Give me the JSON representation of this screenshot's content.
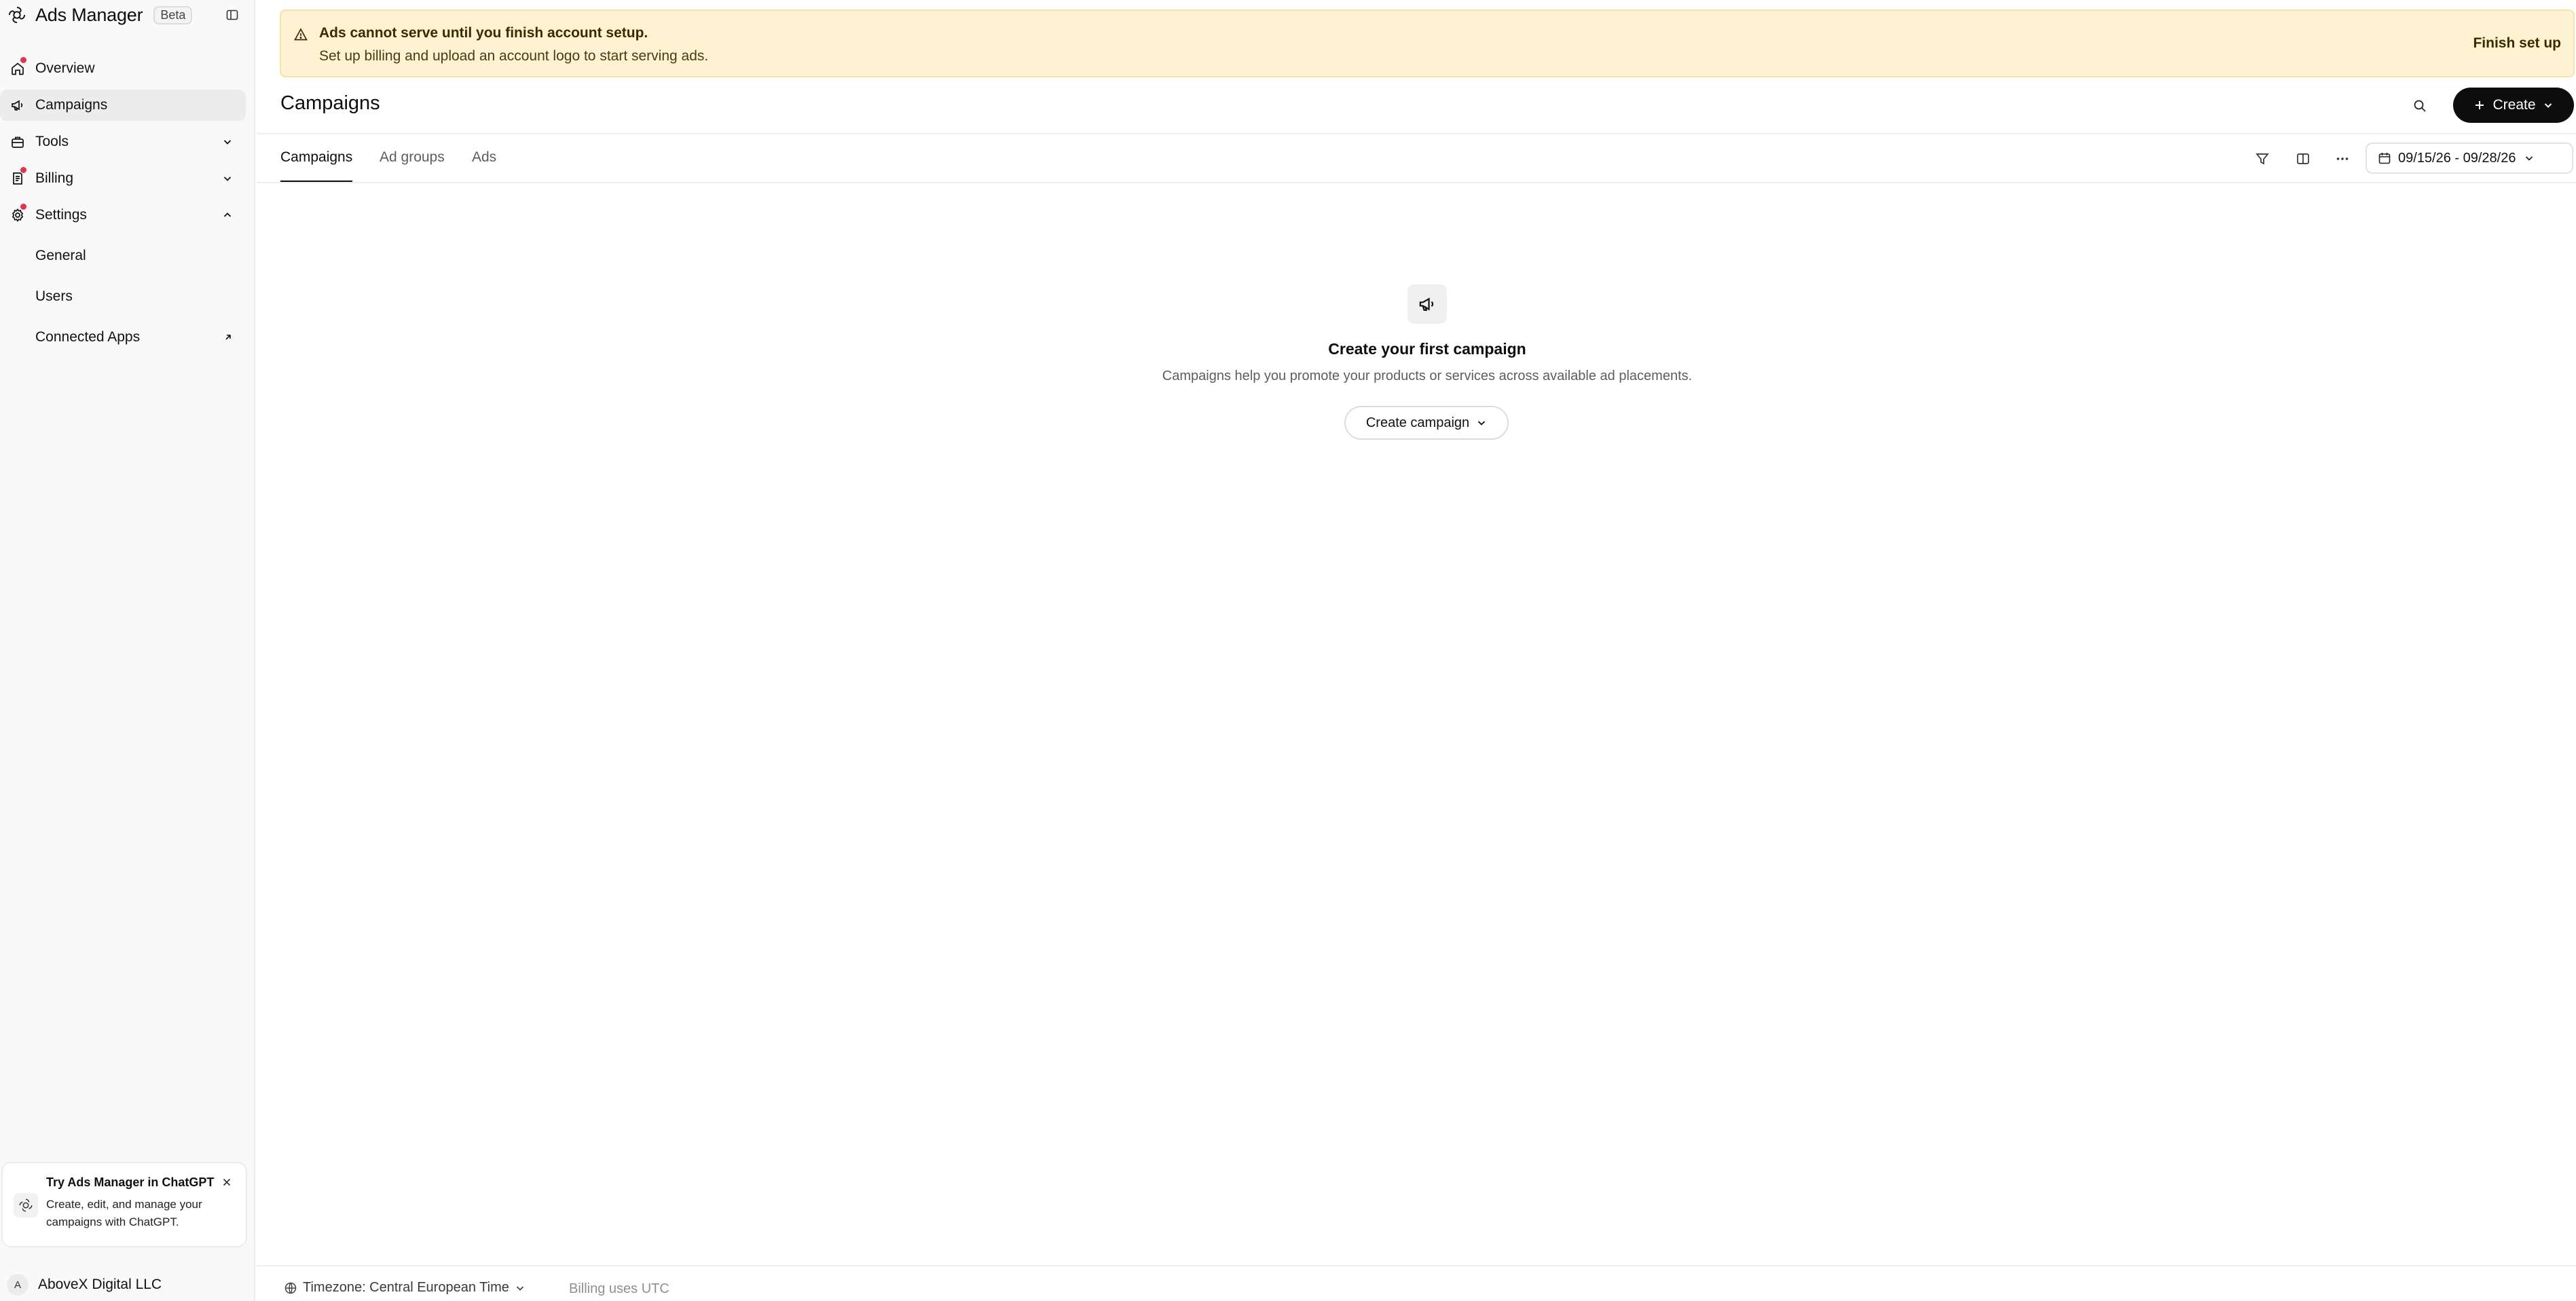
{
  "app": {
    "title": "Ads Manager",
    "badge": "Beta"
  },
  "sidebar": {
    "items": [
      {
        "label": "Overview",
        "icon": "home-icon",
        "notification": true
      },
      {
        "label": "Campaigns",
        "icon": "megaphone-icon",
        "active": true
      },
      {
        "label": "Tools",
        "icon": "briefcase-icon",
        "expandable": true
      },
      {
        "label": "Billing",
        "icon": "receipt-icon",
        "notification": true,
        "expandable": true
      },
      {
        "label": "Settings",
        "icon": "gear-icon",
        "notification": true,
        "expanded": true
      }
    ],
    "settings_sub": [
      {
        "label": "General"
      },
      {
        "label": "Users"
      },
      {
        "label": "Connected Apps",
        "external": true
      }
    ],
    "promo": {
      "title": "Try Ads Manager in ChatGPT",
      "body": "Create, edit, and manage your campaigns with ChatGPT."
    },
    "account": {
      "initial": "A",
      "name": "AboveX Digital LLC"
    }
  },
  "banner": {
    "title": "Ads cannot serve until you finish account setup.",
    "subtitle": "Set up billing and upload an account logo to start serving ads.",
    "action": "Finish set up",
    "color": "#fdf3d3"
  },
  "header": {
    "title": "Campaigns",
    "create_label": "Create"
  },
  "tabs": [
    {
      "label": "Campaigns",
      "active": true
    },
    {
      "label": "Ad groups"
    },
    {
      "label": "Ads"
    }
  ],
  "toolbar": {
    "date_range": "09/15/26 - 09/28/26"
  },
  "empty_state": {
    "title": "Create your first campaign",
    "subtitle": "Campaigns help you promote your products or services across available ad placements.",
    "button": "Create campaign"
  },
  "footer": {
    "timezone": "Timezone: Central European Time",
    "billing_note": "Billing uses UTC"
  },
  "colors": {
    "accent": "#0d0d0d",
    "notification_dot": "#e0344a",
    "warning_bg": "#fdf3d3"
  }
}
